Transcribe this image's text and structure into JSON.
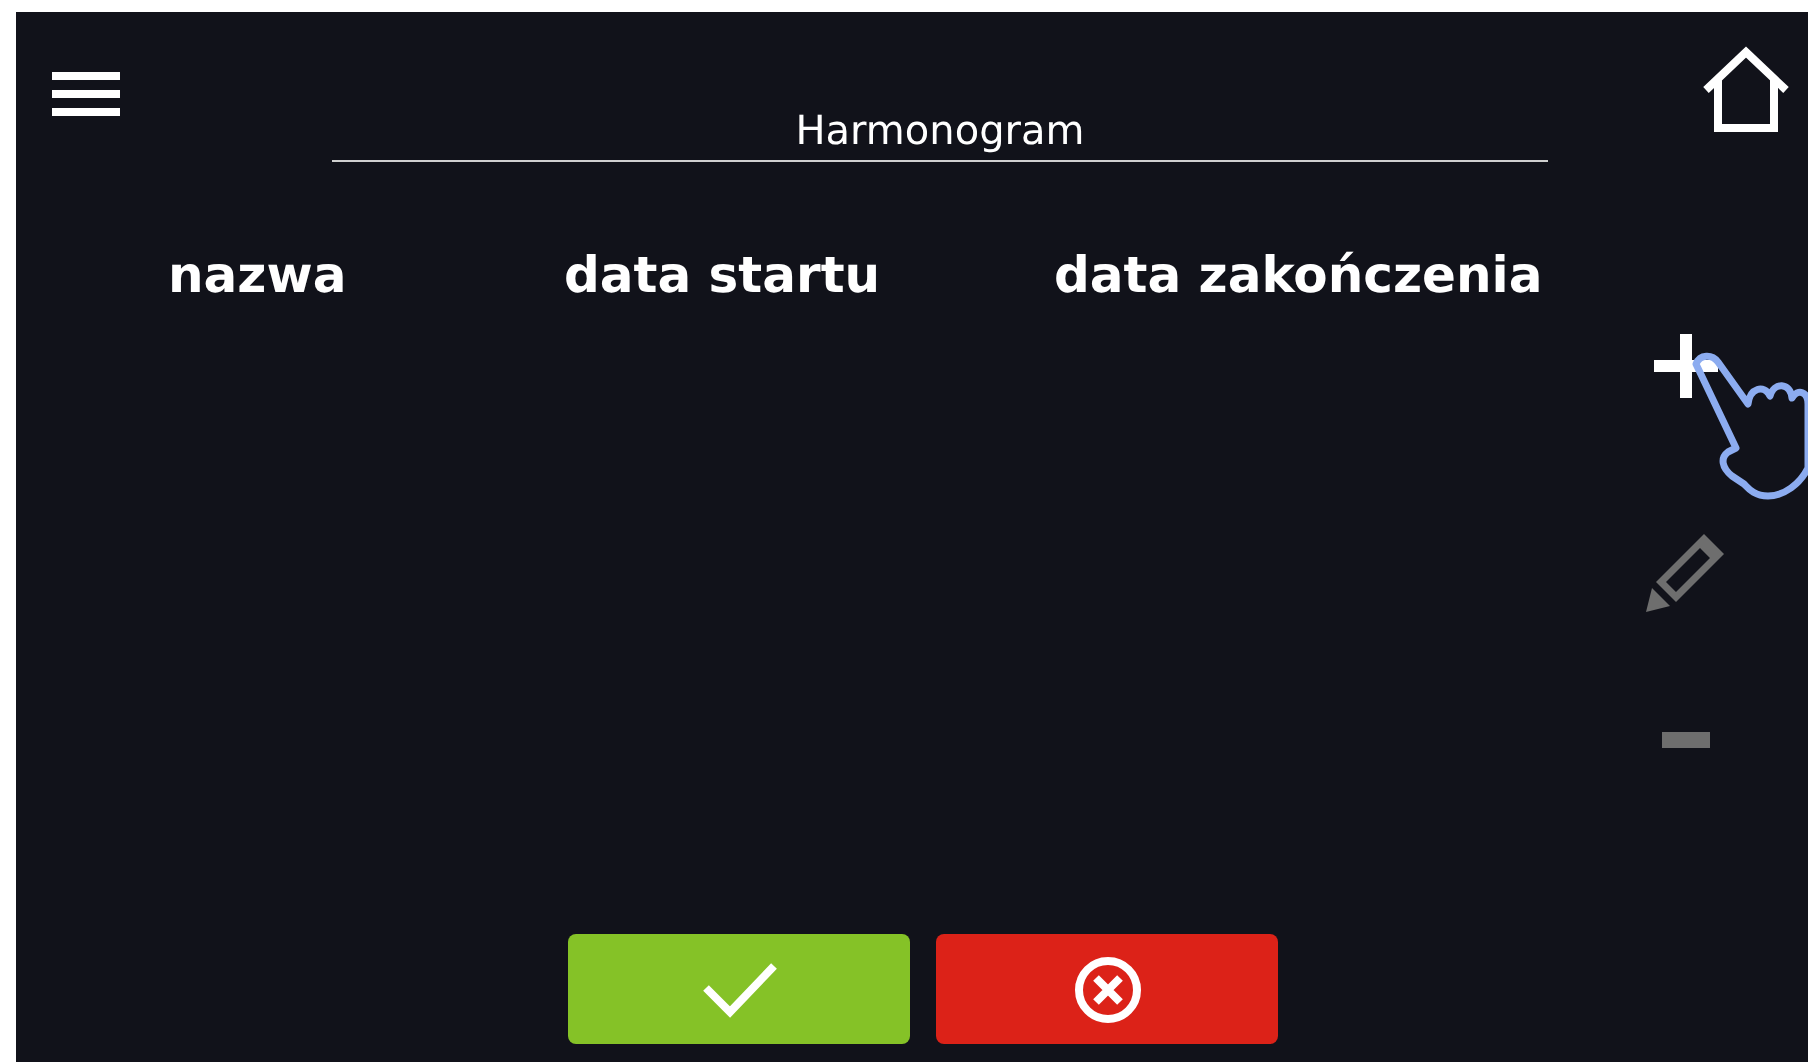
{
  "screen": {
    "title": "Harmonogram"
  },
  "table": {
    "columns": [
      "nazwa",
      "data startu",
      "data zakończenia"
    ]
  },
  "side_actions": [
    {
      "kind": "add",
      "disabled": false
    },
    {
      "kind": "edit",
      "disabled": true
    },
    {
      "kind": "remove",
      "disabled": true
    }
  ],
  "buttons": [
    {
      "kind": "confirm"
    },
    {
      "kind": "cancel"
    }
  ]
}
